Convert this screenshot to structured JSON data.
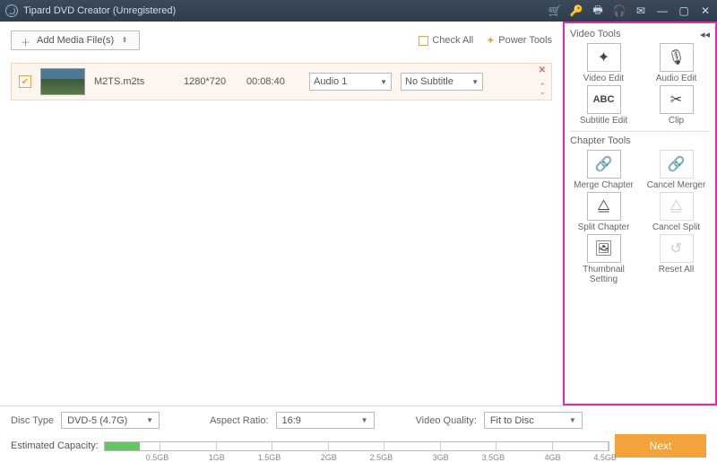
{
  "title": "Tipard DVD Creator (Unregistered)",
  "toolbar": {
    "add_media": "Add Media File(s)",
    "check_all": "Check All",
    "power_tools": "Power Tools"
  },
  "item": {
    "filename": "M2TS.m2ts",
    "resolution": "1280*720",
    "duration": "00:08:40",
    "audio": "Audio 1",
    "subtitle": "No Subtitle"
  },
  "panel": {
    "video_section": "Video Tools",
    "chapter_section": "Chapter Tools",
    "video_edit": "Video Edit",
    "audio_edit": "Audio Edit",
    "subtitle_edit": "Subtitle Edit",
    "clip": "Clip",
    "merge_chapter": "Merge Chapter",
    "cancel_merger": "Cancel Merger",
    "split_chapter": "Split Chapter",
    "cancel_split": "Cancel Split",
    "thumbnail_setting": "Thumbnail Setting",
    "reset_all": "Reset All"
  },
  "footer": {
    "disc_type_label": "Disc Type",
    "disc_type": "DVD-5 (4.7G)",
    "aspect_label": "Aspect Ratio:",
    "aspect": "16:9",
    "quality_label": "Video Quality:",
    "quality": "Fit to Disc",
    "capacity_label": "Estimated Capacity:",
    "ticks": [
      "0.5GB",
      "1GB",
      "1.5GB",
      "2GB",
      "2.5GB",
      "3GB",
      "3.5GB",
      "4GB",
      "4.5GB"
    ],
    "next": "Next"
  }
}
